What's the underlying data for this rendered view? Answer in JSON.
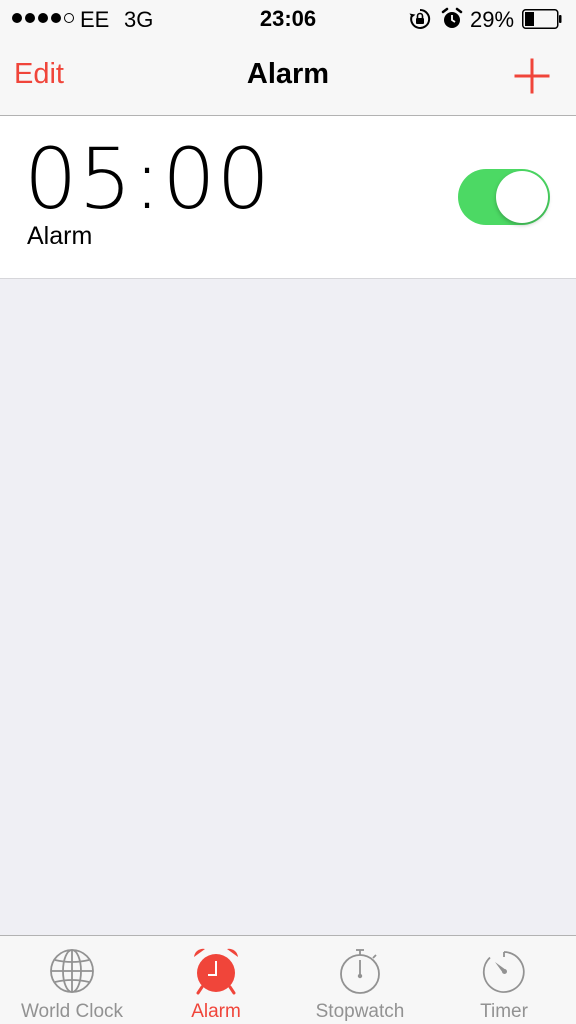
{
  "status_bar": {
    "carrier": "EE",
    "network": "3G",
    "time": "23:06",
    "battery_percent": "29%",
    "battery_level": 0.29,
    "signal_bars_filled": 4,
    "signal_bars_total": 5
  },
  "nav": {
    "edit_label": "Edit",
    "title": "Alarm",
    "add_icon": "plus-icon"
  },
  "alarms": [
    {
      "time": "05:00",
      "label": "Alarm",
      "enabled": true
    }
  ],
  "tabs": [
    {
      "label": "World Clock",
      "icon": "globe-icon",
      "active": false
    },
    {
      "label": "Alarm",
      "icon": "alarm-clock-icon",
      "active": true
    },
    {
      "label": "Stopwatch",
      "icon": "stopwatch-icon",
      "active": false
    },
    {
      "label": "Timer",
      "icon": "timer-icon",
      "active": false
    }
  ],
  "colors": {
    "accent": "#f0453a",
    "toggle_on": "#4cd964",
    "inactive_tab": "#929292",
    "background": "#efeff4"
  }
}
